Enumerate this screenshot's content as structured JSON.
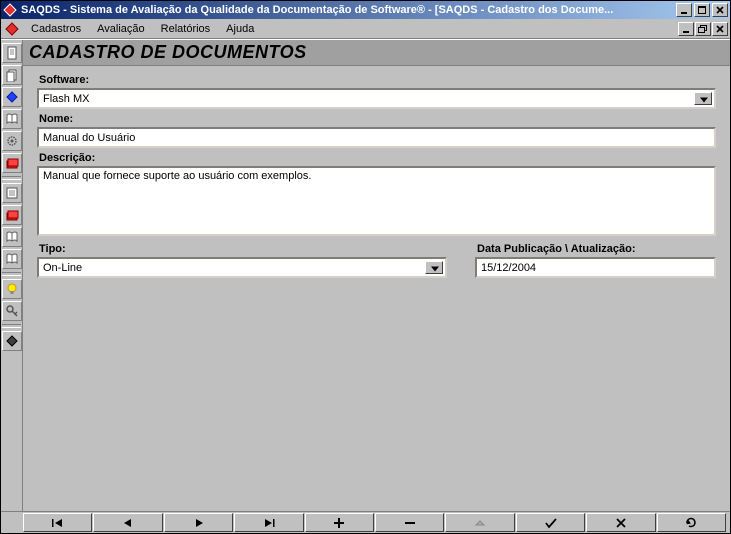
{
  "window": {
    "title": "SAQDS - Sistema de Avaliação da Qualidade da Documentação de Software® - [SAQDS - Cadastro dos Docume..."
  },
  "menu": {
    "items": [
      "Cadastros",
      "Avaliação",
      "Relatórios",
      "Ajuda"
    ]
  },
  "page": {
    "title": "CADASTRO DE DOCUMENTOS"
  },
  "form": {
    "software": {
      "label": "Software:",
      "value": "Flash MX"
    },
    "nome": {
      "label": "Nome:",
      "value": "Manual do Usuário"
    },
    "descricao": {
      "label": "Descrição:",
      "value": "Manual que fornece suporte ao usuário com exemplos."
    },
    "tipo": {
      "label": "Tipo:",
      "value": "On-Line"
    },
    "data": {
      "label": "Data Publicação \\ Atualização:",
      "value": "15/12/2004"
    }
  },
  "icons": {
    "app": "app-diamond-icon"
  }
}
